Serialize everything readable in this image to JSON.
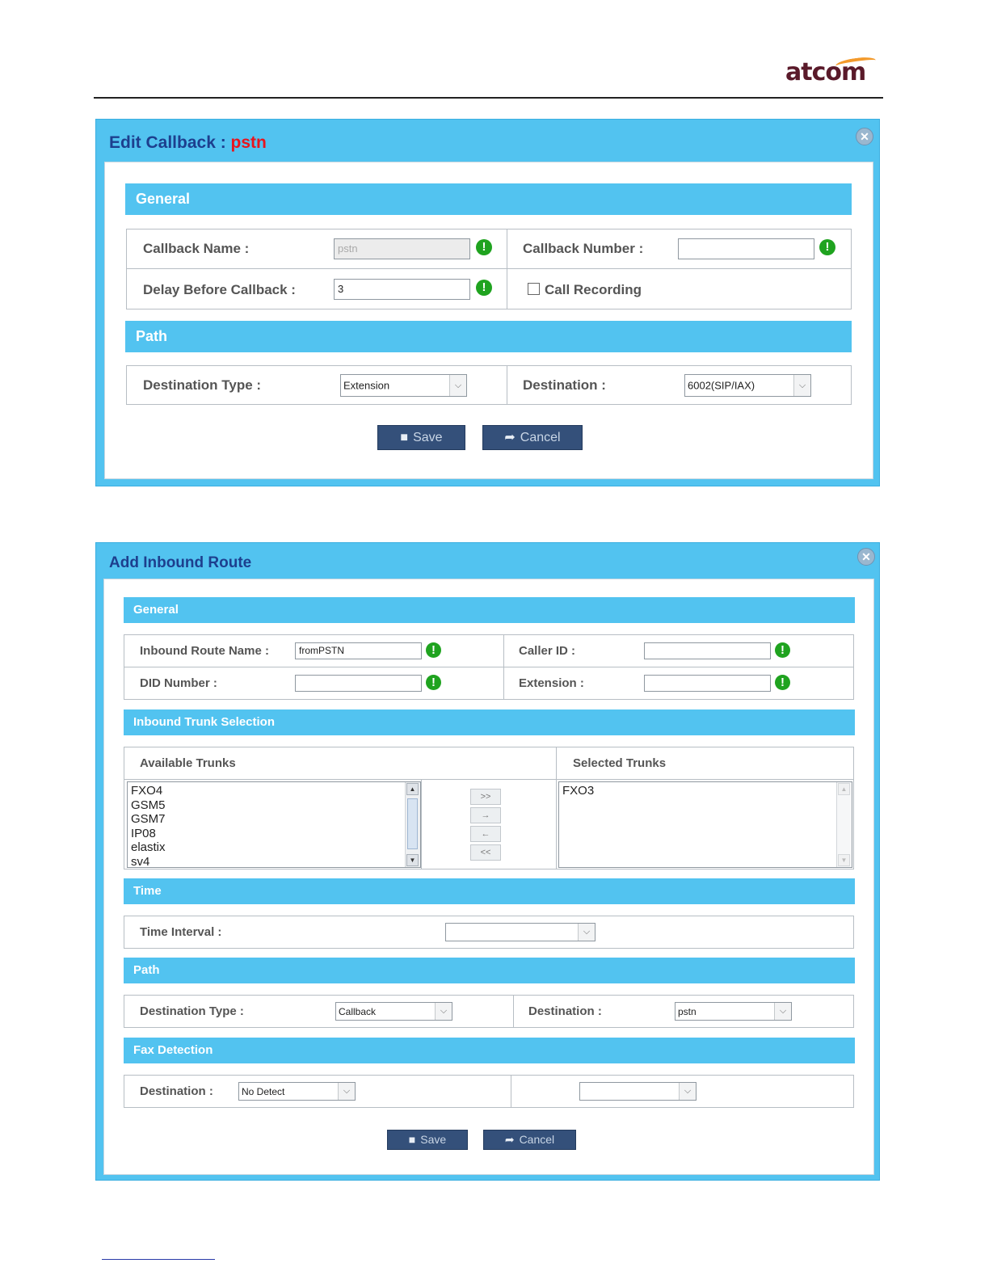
{
  "logo": {
    "text": "atcom"
  },
  "callback_dialog": {
    "title": "Edit Callback : ",
    "title_name": "pstn",
    "close_glyph": "✕",
    "general": {
      "heading": "General",
      "callback_name_label": "Callback Name :",
      "callback_name_value": "pstn",
      "callback_number_label": "Callback Number :",
      "callback_number_value": "",
      "delay_label": "Delay Before Callback :",
      "delay_value": "3",
      "call_recording_label": "Call Recording",
      "call_recording_checked": false
    },
    "path": {
      "heading": "Path",
      "destination_type_label": "Destination Type :",
      "destination_type_value": "Extension",
      "destination_label": "Destination :",
      "destination_value": "6002(SIP/IAX)"
    },
    "save_label": "Save",
    "cancel_label": "Cancel"
  },
  "inbound_dialog": {
    "title": "Add Inbound Route",
    "close_glyph": "✕",
    "general": {
      "heading": "General",
      "route_name_label": "Inbound Route Name :",
      "route_name_value": "fromPSTN",
      "caller_id_label": "Caller ID :",
      "caller_id_value": "",
      "did_label": "DID Number :",
      "did_value": "",
      "extension_label": "Extension :",
      "extension_value": ""
    },
    "trunks": {
      "heading": "Inbound Trunk Selection",
      "available_label": "Available Trunks",
      "selected_label": "Selected Trunks",
      "available": [
        "FXO4",
        "GSM5",
        "GSM7",
        "IP08",
        "elastix",
        "sv4"
      ],
      "selected": [
        "FXO3"
      ],
      "add_all": ">>",
      "add_one": "→",
      "remove_one": "←",
      "remove_all": "<<"
    },
    "time": {
      "heading": "Time",
      "interval_label": "Time Interval :",
      "interval_value": ""
    },
    "path": {
      "heading": "Path",
      "destination_type_label": "Destination Type :",
      "destination_type_value": "Callback",
      "destination_label": "Destination :",
      "destination_value": "pstn"
    },
    "fax": {
      "heading": "Fax Detection",
      "destination_label": "Destination :",
      "destination_value": "No Detect",
      "second_value": ""
    },
    "save_label": "Save",
    "cancel_label": "Cancel"
  },
  "colors": {
    "header_blue": "#52c3f0",
    "title_blue": "#1d3f8e",
    "accent_red": "#e8141d",
    "button_navy": "#34507a",
    "warn_green": "#1fa31f"
  },
  "icons": {
    "warn": "exclamation-icon",
    "save": "floppy-icon",
    "cancel": "arrow-icon",
    "close": "close-icon"
  }
}
